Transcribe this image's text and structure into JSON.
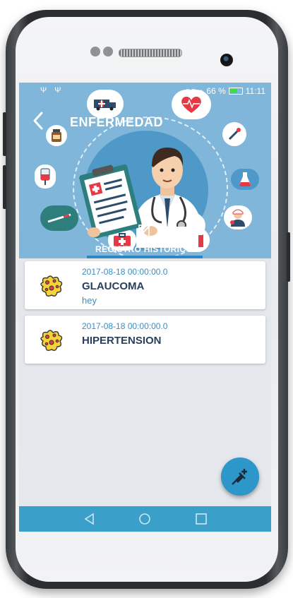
{
  "status_bar": {
    "left_icons": "Ψ Ψ",
    "battery": "66 %",
    "time": "11:11"
  },
  "header": {
    "title": "ENFERMEDAD",
    "tab_label": "REGISTRO HISTORICO",
    "accent_color": "#7fb6d9"
  },
  "records": [
    {
      "date": "2017-08-18 00:00:00.0",
      "name": "GLAUCOMA",
      "note": "hey"
    },
    {
      "date": "2017-08-18 00:00:00.0",
      "name": "HIPERTENSION",
      "note": ""
    }
  ],
  "fab": {
    "icon": "syringe-add-icon",
    "color": "#2e97c9"
  },
  "nav": {
    "icons": [
      "back-triangle-icon",
      "home-circle-icon",
      "recents-square-icon"
    ]
  }
}
